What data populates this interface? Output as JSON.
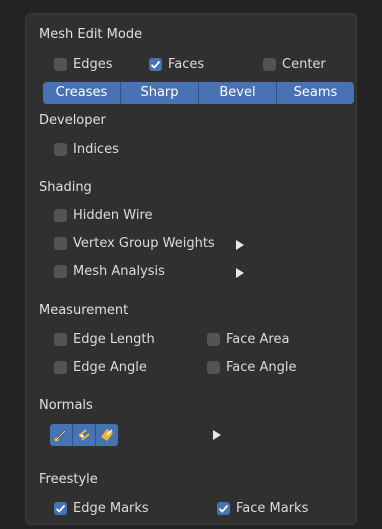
{
  "mesh_edit_mode": {
    "title": "Mesh Edit Mode",
    "edges": {
      "label": "Edges",
      "checked": false
    },
    "faces": {
      "label": "Faces",
      "checked": true
    },
    "center": {
      "label": "Center",
      "checked": false
    },
    "buttons": [
      "Creases",
      "Sharp",
      "Bevel",
      "Seams"
    ]
  },
  "developer": {
    "title": "Developer",
    "indices": {
      "label": "Indices",
      "checked": false
    }
  },
  "shading": {
    "title": "Shading",
    "hidden_wire": {
      "label": "Hidden Wire",
      "checked": false
    },
    "vertex_group_weights": {
      "label": "Vertex Group Weights",
      "checked": false
    },
    "mesh_analysis": {
      "label": "Mesh Analysis",
      "checked": false
    }
  },
  "measurement": {
    "title": "Measurement",
    "edge_length": {
      "label": "Edge Length",
      "checked": false
    },
    "face_area": {
      "label": "Face Area",
      "checked": false
    },
    "edge_angle": {
      "label": "Edge Angle",
      "checked": false
    },
    "face_angle": {
      "label": "Face Angle",
      "checked": false
    }
  },
  "normals": {
    "title": "Normals",
    "buttons": [
      "vertex-normals-icon",
      "split-normals-icon",
      "face-normals-icon"
    ]
  },
  "freestyle": {
    "title": "Freestyle",
    "edge_marks": {
      "label": "Edge Marks",
      "checked": true
    },
    "face_marks": {
      "label": "Face Marks",
      "checked": true
    }
  },
  "colors": {
    "accent": "#4772b3",
    "panel": "#303030",
    "background": "#232323"
  }
}
